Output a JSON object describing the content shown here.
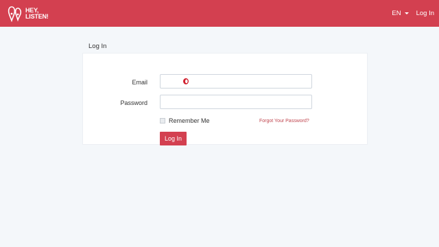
{
  "navbar": {
    "logo_line1": "HEY,",
    "logo_line2": "LISTEN!",
    "language": "EN",
    "login_link": "Log In",
    "color": "#d34050"
  },
  "panel": {
    "heading": "Log In",
    "email_label": "Email",
    "email_value": "",
    "password_label": "Password",
    "password_value": "",
    "remember_label": "Remember Me",
    "remember_checked": false,
    "forgot_link": "Forgot Your Password?",
    "submit_label": "Log In"
  },
  "icons": {
    "email_field_icon": "password-manager-icon",
    "language_caret": "caret-down-icon",
    "logo": "heart-logo-icon"
  }
}
